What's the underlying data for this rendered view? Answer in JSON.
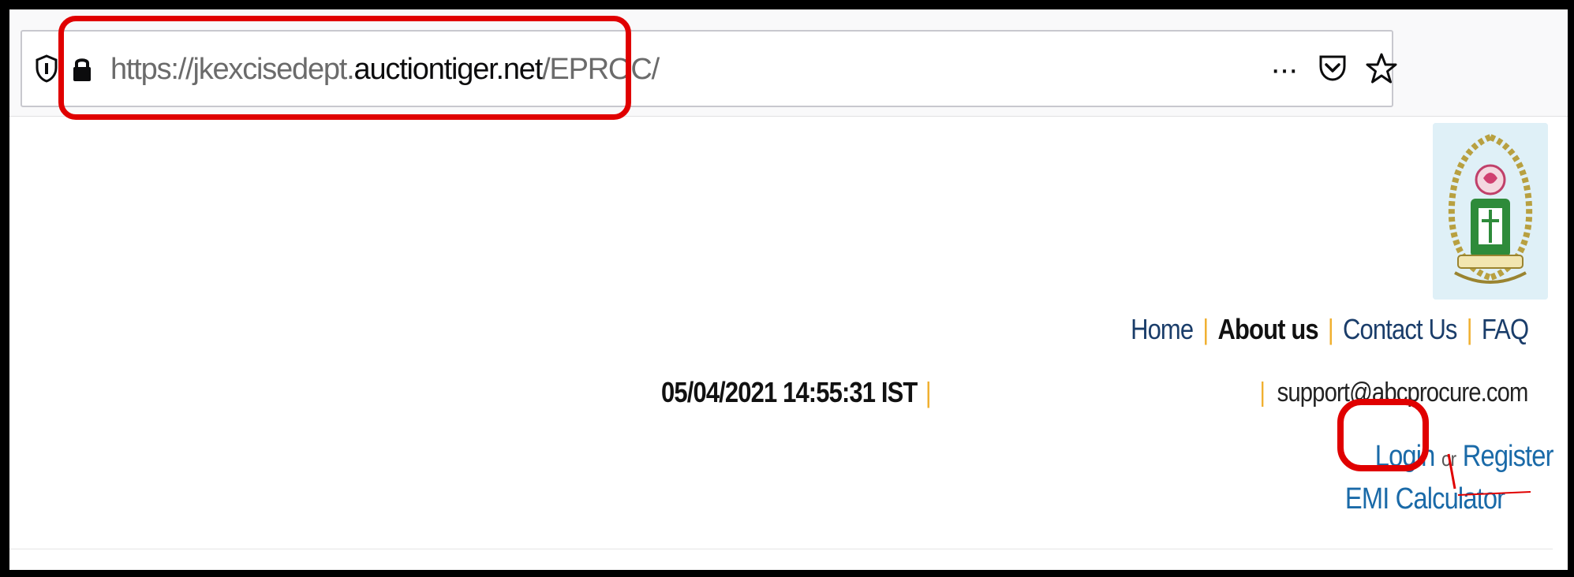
{
  "browser": {
    "url": {
      "prefix": "https://jkexcisedept.",
      "host": "auctiontiger.net",
      "path": "/EPROC/"
    },
    "toolbar_icons": [
      "shield-icon",
      "lock-icon",
      "more-icon",
      "pocket-icon",
      "star-icon"
    ],
    "more_label": "···"
  },
  "header": {
    "emblem": "state-emblem",
    "nav": {
      "home": "Home",
      "about": "About us",
      "contact": "Contact Us",
      "faq": "FAQ",
      "separator": "|"
    },
    "datetime": "05/04/2021 14:55:31 IST",
    "support_email": "support@abcprocure.com",
    "auth": {
      "login": "Login",
      "or": "or",
      "register": "Register"
    },
    "emi_calculator": "EMI Calculator"
  },
  "annotations": {
    "highlight_color": "#e00000"
  },
  "colors": {
    "link": "#1a6aa8",
    "separator": "#f0b030",
    "frame": "#000000"
  }
}
